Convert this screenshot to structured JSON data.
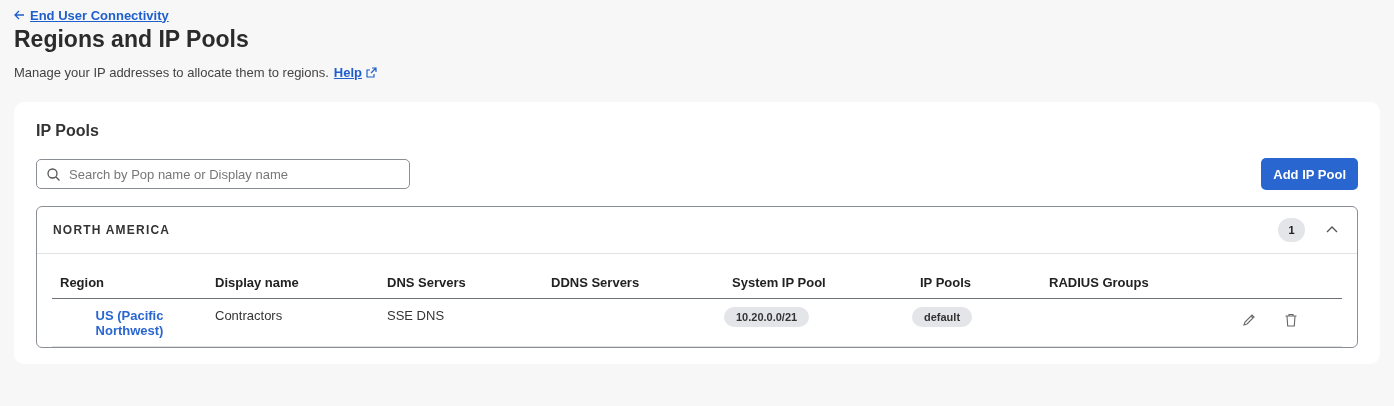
{
  "breadcrumb": {
    "back_label": "End User Connectivity"
  },
  "page_title": "Regions and IP Pools",
  "description": {
    "text": "Manage your IP addresses to allocate them to regions.",
    "help_link": "Help"
  },
  "card": {
    "title": "IP Pools",
    "search": {
      "placeholder": "Search by Pop name or Display name"
    },
    "add_button": "Add IP Pool",
    "groups": [
      {
        "name": "NORTH AMERICA",
        "count": "1",
        "expanded": true,
        "columns": [
          "Region",
          "Display name",
          "DNS Servers",
          "DDNS Servers",
          "System IP Pool",
          "IP Pools",
          "RADIUS Groups"
        ],
        "rows": [
          {
            "region": "US (Pacific Northwest)",
            "display_name": "Contractors",
            "dns_servers": "SSE DNS",
            "system_ip_pool": "10.20.0.0/21",
            "ip_pools": [
              "default"
            ]
          }
        ]
      }
    ]
  }
}
